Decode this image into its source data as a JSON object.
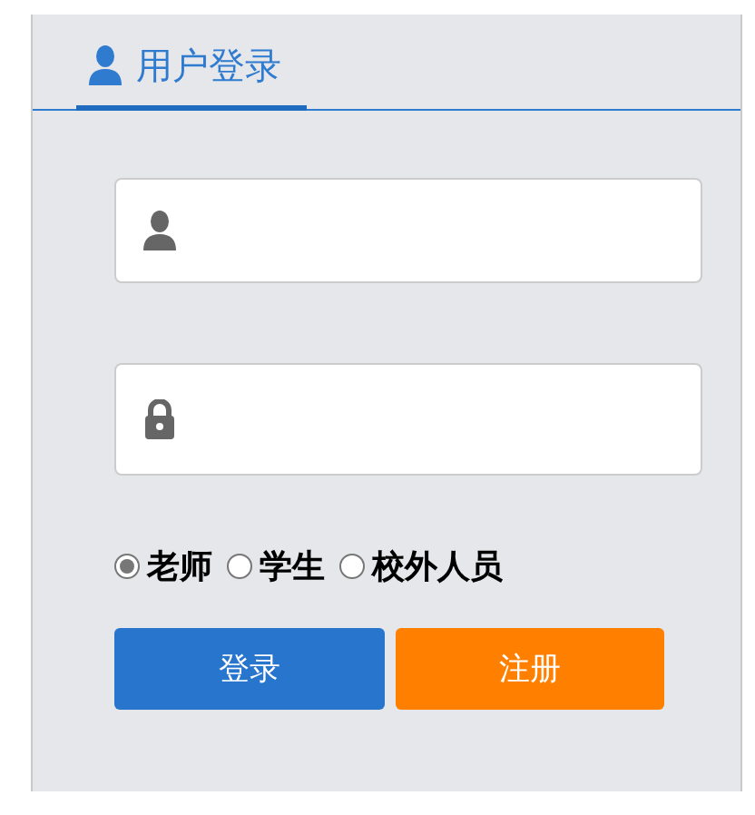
{
  "tab": {
    "label": "用户登录",
    "selected": true
  },
  "fields": [
    {
      "kind": "user"
    },
    {
      "kind": "password"
    }
  ],
  "roles": [
    {
      "label": "老师",
      "selected": true
    },
    {
      "label": "学生",
      "selected": false
    },
    {
      "label": "校外人员",
      "selected": false
    }
  ],
  "buttons": [
    {
      "label": "登录",
      "kind": "primary"
    },
    {
      "label": "注册",
      "kind": "secondary"
    }
  ]
}
